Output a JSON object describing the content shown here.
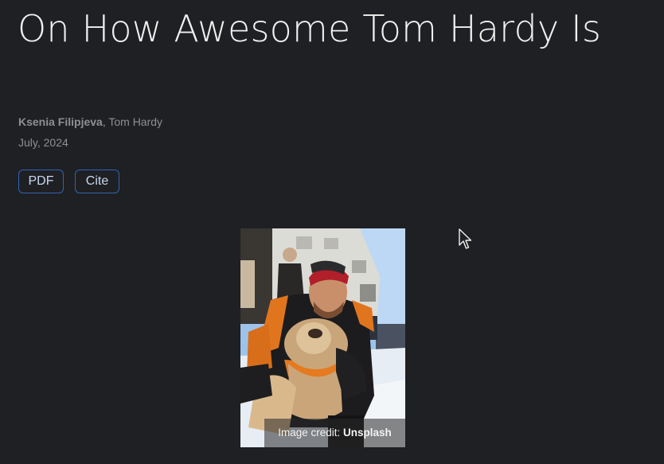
{
  "article": {
    "title": "On How Awesome Tom Hardy Is",
    "authors": {
      "first": "Ksenia Filipjeva",
      "separator": ", ",
      "rest": "Tom Hardy"
    },
    "date": "July, 2024"
  },
  "buttons": {
    "pdf": "PDF",
    "cite": "Cite"
  },
  "figure": {
    "credit_prefix": "Image credit: ",
    "credit_source": "Unsplash"
  },
  "icons": {
    "cursor": "mouse-pointer-icon"
  },
  "colors": {
    "background": "#1f2023",
    "button_border": "#2f63b5",
    "meta_text": "#8d8f93"
  }
}
